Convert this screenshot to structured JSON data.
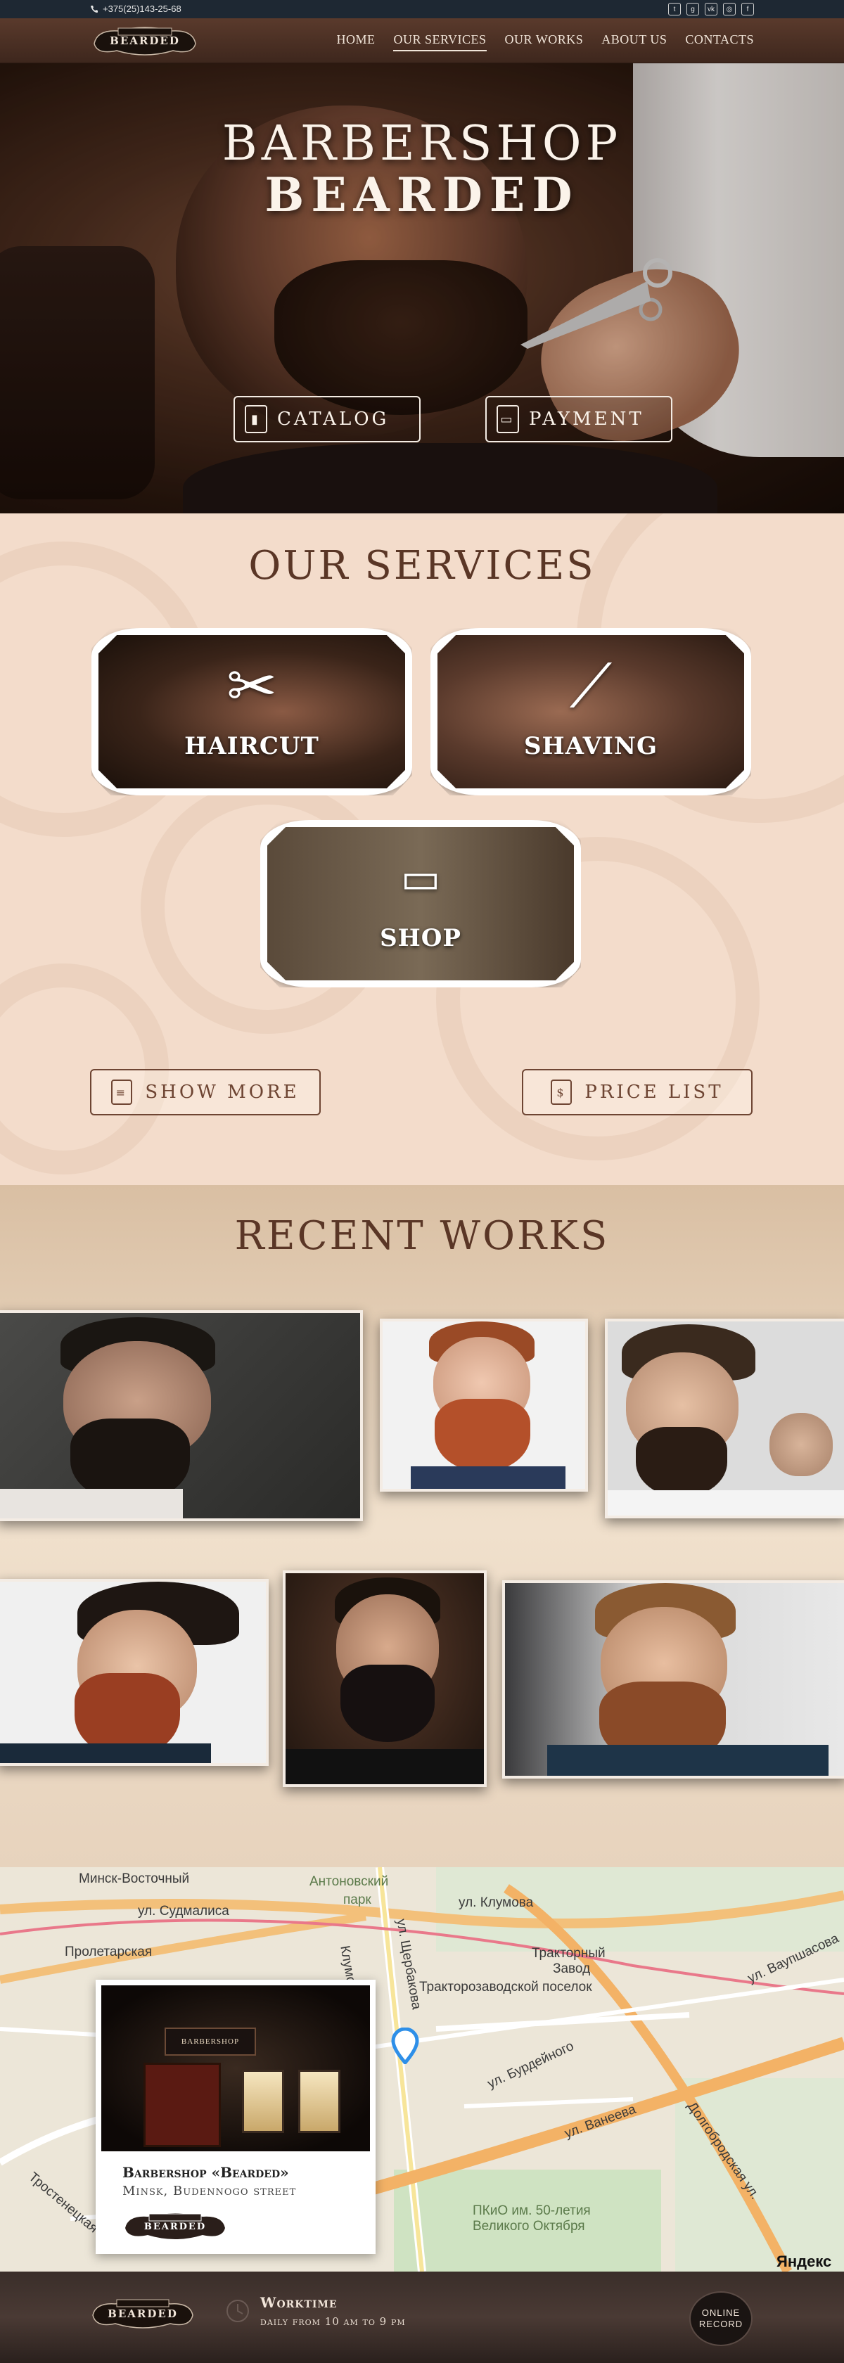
{
  "topbar": {
    "phone": "+375(25)143-25-68",
    "social_icons": [
      "twitter-icon",
      "google-plus-icon",
      "vk-icon",
      "instagram-icon",
      "facebook-icon"
    ]
  },
  "logo": {
    "text": "BEARDED"
  },
  "nav": {
    "items": [
      {
        "label": "HOME"
      },
      {
        "label": "OUR SERVICES",
        "active": true
      },
      {
        "label": "OUR WORKS"
      },
      {
        "label": "ABOUT US"
      },
      {
        "label": "CONTACTS"
      }
    ]
  },
  "hero": {
    "title_line1": "BARBERSHOP",
    "title_line2": "BEARDED",
    "catalog_label": "CATALOG",
    "payment_label": "PAYMENT"
  },
  "services": {
    "title": "OUR SERVICES",
    "tiles": [
      {
        "label": "HAIRCUT",
        "icon": "scissors-comb-icon"
      },
      {
        "label": "SHAVING",
        "icon": "razor-icon"
      },
      {
        "label": "SHOP",
        "icon": "blade-icon"
      }
    ],
    "show_more_label": "SHOW MORE",
    "price_list_label": "PRICE LIST"
  },
  "works": {
    "title": "RECENT WORKS"
  },
  "map": {
    "labels": [
      "Минск-Восточный",
      "ул. Судмалиса",
      "Пролетарская",
      "Антоновский",
      "парк",
      "ул. Клумова",
      "Клумова",
      "ул. Щербакова",
      "Тракторный",
      "Завод",
      "Тракторозаводской поселок",
      "ул. Ваупшасова",
      "ул. Бурдейного",
      "ул. Ванеева",
      "Долгобродская ул.",
      "Тростенецкая",
      "ПКиО им. 50-летия",
      "Великого Октября"
    ],
    "provider": "Яндекс",
    "card": {
      "title": "Barbershop «Bearded»",
      "address": "Minsk, Budennogo street",
      "logo_text": "BEARDED",
      "shop_sign": "BARBERSHOP"
    }
  },
  "footer": {
    "logo_text": "BEARDED",
    "worktime_label": "Worktime",
    "worktime_hours": "daily from 10 am to 9 pm",
    "online_line1": "ONLINE",
    "online_line2": "RECORD"
  },
  "colors": {
    "topbar_bg": "#1e2833",
    "nav_bg": "#4a3022",
    "services_bg": "#f3dccb",
    "accent_brown": "#6e4533",
    "footer_bg": "#3a2e2a"
  }
}
